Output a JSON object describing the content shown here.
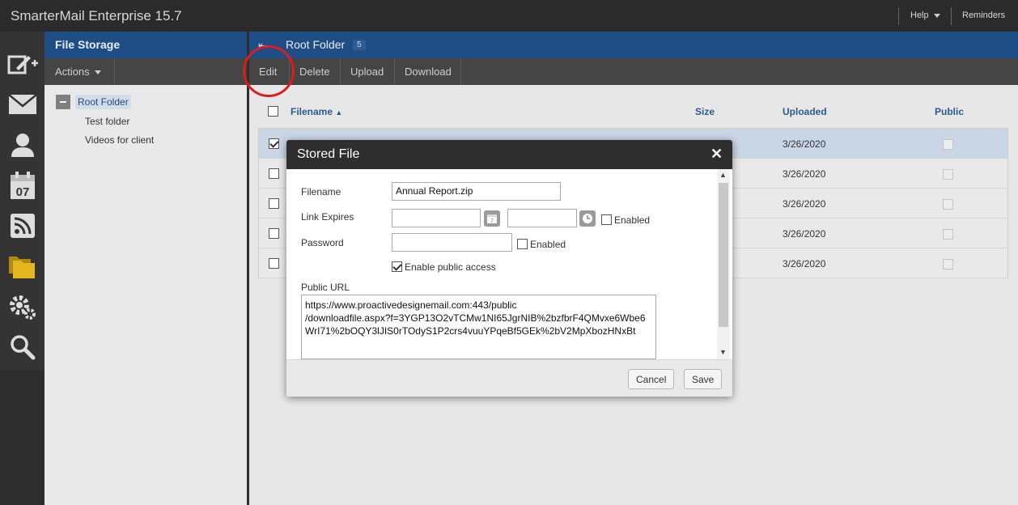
{
  "app": {
    "title": "SmarterMail Enterprise 15.7",
    "help_label": "Help",
    "reminders_label": "Reminders"
  },
  "rail": {
    "icons": [
      "compose-icon",
      "mail-icon",
      "contacts-icon",
      "calendar-icon",
      "rss-icon",
      "file-storage-icon",
      "settings-icon",
      "search-icon"
    ],
    "calendar_day": "07"
  },
  "left_panel": {
    "title": "File Storage",
    "actions_label": "Actions",
    "tree": {
      "root": "Root Folder",
      "children": [
        "Test folder",
        "Videos for client"
      ]
    }
  },
  "main": {
    "folder_title": "Root Folder",
    "count": "5",
    "toolbar": {
      "edit": "Edit",
      "delete": "Delete",
      "upload": "Upload",
      "download": "Download"
    },
    "columns": {
      "filename": "Filename",
      "size": "Size",
      "uploaded": "Uploaded",
      "public": "Public"
    },
    "rows": [
      {
        "uploaded": "3/26/2020",
        "selected": true
      },
      {
        "uploaded": "3/26/2020",
        "selected": false
      },
      {
        "uploaded": "3/26/2020",
        "selected": false
      },
      {
        "uploaded": "3/26/2020",
        "selected": false
      },
      {
        "uploaded": "3/26/2020",
        "selected": false
      }
    ]
  },
  "modal": {
    "title": "Stored File",
    "filename_label": "Filename",
    "filename_value": "Annual Report.zip",
    "link_expires_label": "Link Expires",
    "link_expires_date": "",
    "link_expires_time": "",
    "enabled_label": "Enabled",
    "password_label": "Password",
    "password_value": "",
    "password_enabled_label": "Enabled",
    "public_access_label": "Enable public access",
    "public_access_checked": true,
    "public_url_label": "Public URL",
    "public_url_lines": [
      "https://www.proactivedesignemail.com:443/public",
      "/downloadfile.aspx?f=3YGP13O2vTCMw1NI65JgrNIB%2bzfbrF4QMvxe6Wbe6",
      "WrI71%2bOQY3lJIS0rTOdyS1P2crs4vuuYPqeBf5GEk%2bV2MpXbozHNxBt"
    ],
    "cancel_label": "Cancel",
    "save_label": "Save"
  },
  "colors": {
    "header_blue": "#1f4e86",
    "toolbar_gray": "#454545",
    "annotation_red": "#e01b1b"
  }
}
